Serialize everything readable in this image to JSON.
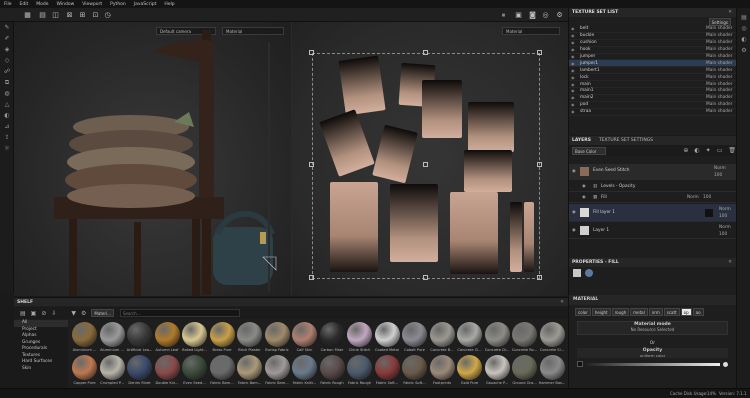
{
  "menu": [
    "File",
    "Edit",
    "Mode",
    "Window",
    "Viewport",
    "Python",
    "JavaScript",
    "Help"
  ],
  "viewport": {
    "camera_dropdown": "Default camera",
    "left_mode_dropdown": "Material",
    "right_mode_dropdown": "Material"
  },
  "texture_set_list": {
    "title": "TEXTURE SET LIST",
    "settings_label": "Settings",
    "items": [
      {
        "name": "belt",
        "shader": "Main shader"
      },
      {
        "name": "buckle",
        "shader": "Main shader"
      },
      {
        "name": "cushion",
        "shader": "Main shader"
      },
      {
        "name": "hook",
        "shader": "Main shader"
      },
      {
        "name": "jumper",
        "shader": "Main shader"
      },
      {
        "name": "jumper1",
        "shader": "Main shader"
      },
      {
        "name": "lambert1",
        "shader": "Main shader"
      },
      {
        "name": "lock",
        "shader": "Main shader"
      },
      {
        "name": "main",
        "shader": "Main shader"
      },
      {
        "name": "main1",
        "shader": "Main shader"
      },
      {
        "name": "main2",
        "shader": "Main shader"
      },
      {
        "name": "pod",
        "shader": "Main shader"
      },
      {
        "name": "straa",
        "shader": "Main shader"
      }
    ],
    "selected": "jumper1"
  },
  "layers": {
    "tab_layers": "LAYERS",
    "tab_tss": "TEXTURE SET SETTINGS",
    "channel_dropdown": "Base Color",
    "rows": [
      {
        "name": "Even Seed Stitch",
        "blend": "Norm",
        "opacity": "100"
      },
      {
        "name": "Levels - Opacity",
        "blend": "",
        "opacity": ""
      },
      {
        "name": "Fill",
        "blend": "Norm",
        "opacity": "100"
      },
      {
        "name": "Fill layer 1",
        "blend": "Norm",
        "opacity": "100"
      },
      {
        "name": "Layer 1",
        "blend": "Norm",
        "opacity": "100"
      }
    ]
  },
  "properties": {
    "title": "PROPERTIES - FILL",
    "section": "MATERIAL",
    "channels": [
      "color",
      "height",
      "rough",
      "metal",
      "nrm",
      "scatt",
      "op",
      "ao"
    ],
    "active_channel": "op",
    "material_mode_label": "Material mode",
    "material_mode_value": "No Resource Selected",
    "or_label": "Or",
    "opacity_label": "Opacity",
    "opacity_sub": "uniform color"
  },
  "shelf": {
    "title": "SHELF",
    "categories": [
      "All",
      "Project",
      "Alphas",
      "Grunges",
      "Procedurals",
      "Textures",
      "Hard Surfaces",
      "Skin"
    ],
    "selected_category": "All",
    "filter_chip": "Materi...",
    "search_placeholder": "Search...",
    "materials_row1": [
      {
        "name": "Aluminium ...",
        "color": "#8a6a3a"
      },
      {
        "name": "Aluminium ...",
        "color": "#9a9a9a"
      },
      {
        "name": "Artificial Lea...",
        "color": "#3a3a3a"
      },
      {
        "name": "Autumn Leaf",
        "color": "#b07a2a"
      },
      {
        "name": "Baked Light...",
        "color": "#d8c890"
      },
      {
        "name": "Brass Pure",
        "color": "#c8a048"
      },
      {
        "name": "Brick Plaster",
        "color": "#8a8a86"
      },
      {
        "name": "Burlap Fabric",
        "color": "#a08a6a"
      },
      {
        "name": "Calf Skin",
        "color": "#b08070"
      },
      {
        "name": "Carbon Fiber",
        "color": "#2a2a2a"
      },
      {
        "name": "Chine Stitch",
        "color": "#c0a8c0"
      },
      {
        "name": "Coated Metal",
        "color": "#d0d0d0"
      },
      {
        "name": "Cobalt Pure",
        "color": "#8a8a92"
      },
      {
        "name": "Concrete B...",
        "color": "#9a9890"
      },
      {
        "name": "Concrete Cl...",
        "color": "#a8a8a4"
      },
      {
        "name": "Concrete Di...",
        "color": "#8e8c86"
      },
      {
        "name": "Concrete Ro...",
        "color": "#7a7872"
      },
      {
        "name": "Concrete Si...",
        "color": "#9c9a94"
      }
    ],
    "materials_row2": [
      {
        "name": "Copper Pure",
        "color": "#c07850"
      },
      {
        "name": "Crumpled P...",
        "color": "#b8b4aa"
      },
      {
        "name": "Denim Rivet",
        "color": "#3a4a6a"
      },
      {
        "name": "Double Kni...",
        "color": "#8a4a4a"
      },
      {
        "name": "Even Seed...",
        "color": "#3a4a3a"
      },
      {
        "name": "Fabric Bam...",
        "color": "#6a6a6a"
      },
      {
        "name": "Fabric Bam...",
        "color": "#aa9a7a"
      },
      {
        "name": "Fabric Bam...",
        "color": "#a09a9a"
      },
      {
        "name": "Fabric Knitt...",
        "color": "#6a7a8a"
      },
      {
        "name": "Fabric Rough",
        "color": "#5a4a4a"
      },
      {
        "name": "Fabric Rough",
        "color": "#4a5a6a"
      },
      {
        "name": "Fabric Soft...",
        "color": "#8a3a3a"
      },
      {
        "name": "Fabric Soft...",
        "color": "#6a5a4a"
      },
      {
        "name": "Footprints",
        "color": "#9a8a7a"
      },
      {
        "name": "Gold Pure",
        "color": "#d0a848"
      },
      {
        "name": "Gouache P...",
        "color": "#c8c4bc"
      },
      {
        "name": "Ground Gra...",
        "color": "#6a6a5a"
      },
      {
        "name": "Hammer Bas...",
        "color": "#8a8a8a"
      }
    ]
  },
  "status": {
    "cache": "Cache Disk Usage:",
    "cache_pct": "14%",
    "version": "Version: 7.1.1"
  }
}
